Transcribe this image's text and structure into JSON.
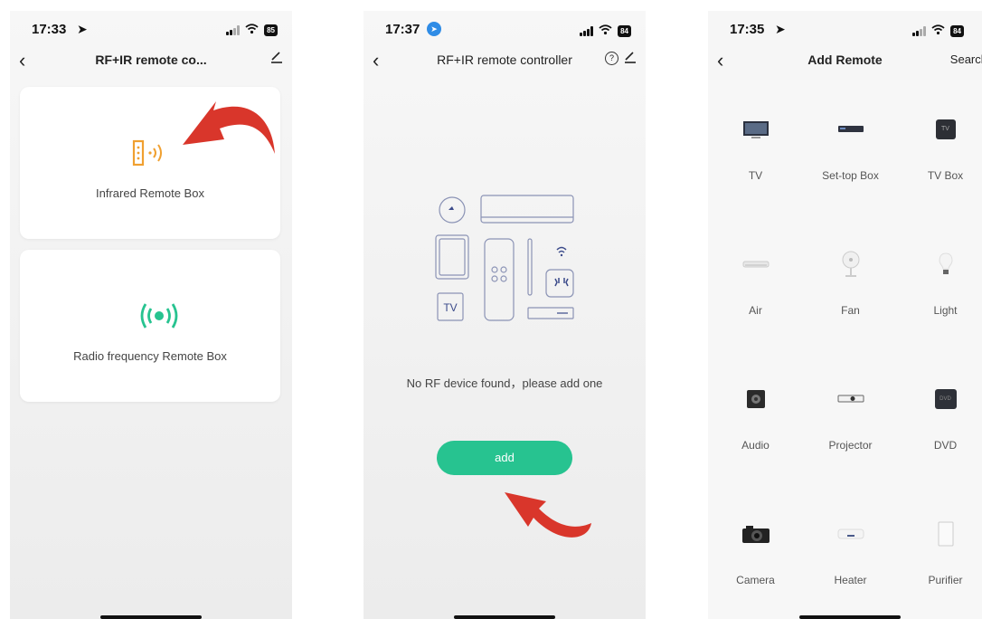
{
  "phone1": {
    "time": "17:33",
    "battery": "85",
    "title": "RF+IR remote co...",
    "cards": [
      {
        "label": "Infrared Remote Box"
      },
      {
        "label": "Radio frequency Remote Box"
      }
    ]
  },
  "phone2": {
    "time": "17:37",
    "battery": "84",
    "title": "RF+IR remote controller",
    "illustration_tv": "TV",
    "empty_text": "No RF device found，please add one",
    "add_label": "add"
  },
  "phone3": {
    "time": "17:35",
    "battery": "84",
    "title": "Add Remote",
    "search_label": "Search",
    "items": [
      {
        "label": "TV",
        "icon": "tv-icon"
      },
      {
        "label": "Set-top Box",
        "icon": "set-top-box-icon"
      },
      {
        "label": "TV Box",
        "icon": "tv-box-icon"
      },
      {
        "label": "Air",
        "icon": "air-conditioner-icon"
      },
      {
        "label": "Fan",
        "icon": "fan-icon"
      },
      {
        "label": "Light",
        "icon": "light-bulb-icon"
      },
      {
        "label": "Audio",
        "icon": "speaker-icon"
      },
      {
        "label": "Projector",
        "icon": "projector-icon"
      },
      {
        "label": "DVD",
        "icon": "dvd-icon"
      },
      {
        "label": "Camera",
        "icon": "camera-icon"
      },
      {
        "label": "Heater",
        "icon": "heater-icon"
      },
      {
        "label": "Purifier",
        "icon": "purifier-icon"
      }
    ],
    "tvbox_icon_text": "TV",
    "dvd_icon_text": "DVD"
  },
  "colors": {
    "accent_green": "#27c390",
    "infrared_orange": "#f0a030",
    "annotation_red": "#d9362b"
  }
}
